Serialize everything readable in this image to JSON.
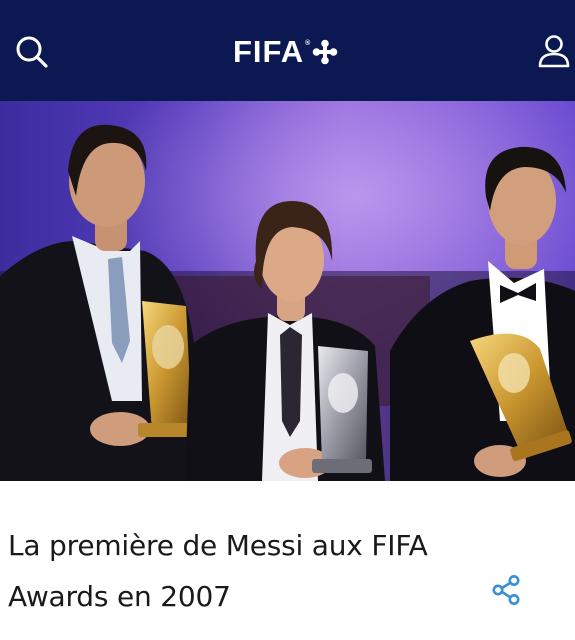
{
  "header": {
    "logo_text": "FIFA",
    "logo_mark": "®",
    "background": "#0b1852",
    "search_icon": "search-icon",
    "profile_icon": "user-icon",
    "logo_plus_icon": "fifa-plus-icon"
  },
  "hero": {
    "image": "photo-three-players-with-trophies"
  },
  "article": {
    "title": "La première de Messi aux FIFA Awards en 2007",
    "share_icon": "share-icon",
    "accent": "#3a8fd6"
  }
}
